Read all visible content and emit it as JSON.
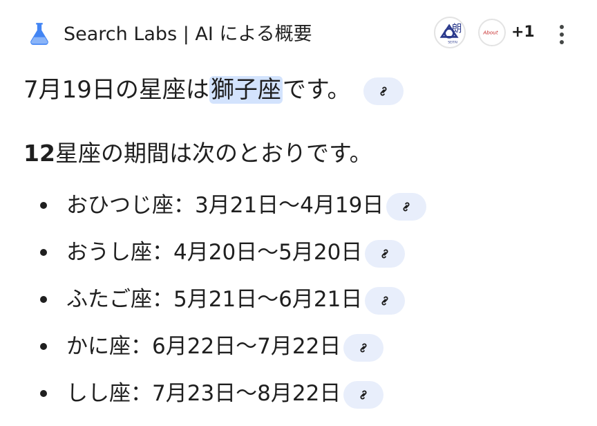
{
  "header": {
    "title": "Search Labs | AI による概要",
    "sources_extra_count": "+1",
    "source1_logo_text": "朗",
    "source1_subtext": "SEITAI",
    "source2_logo_text": "About"
  },
  "headline": {
    "prefix": "7月19日の星座は",
    "highlight": "獅子座",
    "suffix": "です。"
  },
  "intro": {
    "bold": "12",
    "rest": "星座の期間は次のとおりです。"
  },
  "zodiac_items": [
    {
      "text": "おひつじ座：3月21日〜4月19日"
    },
    {
      "text": "おうし座：4月20日〜5月20日"
    },
    {
      "text": "ふたご座：5月21日〜6月21日"
    },
    {
      "text": "かに座：6月22日〜7月22日"
    },
    {
      "text": "しし座：7月23日〜8月22日"
    }
  ],
  "colors": {
    "accent": "#1a73e8",
    "highlight_bg": "#d3e3fd",
    "chip_bg": "#e8eefb",
    "text": "#1f1f1f"
  }
}
